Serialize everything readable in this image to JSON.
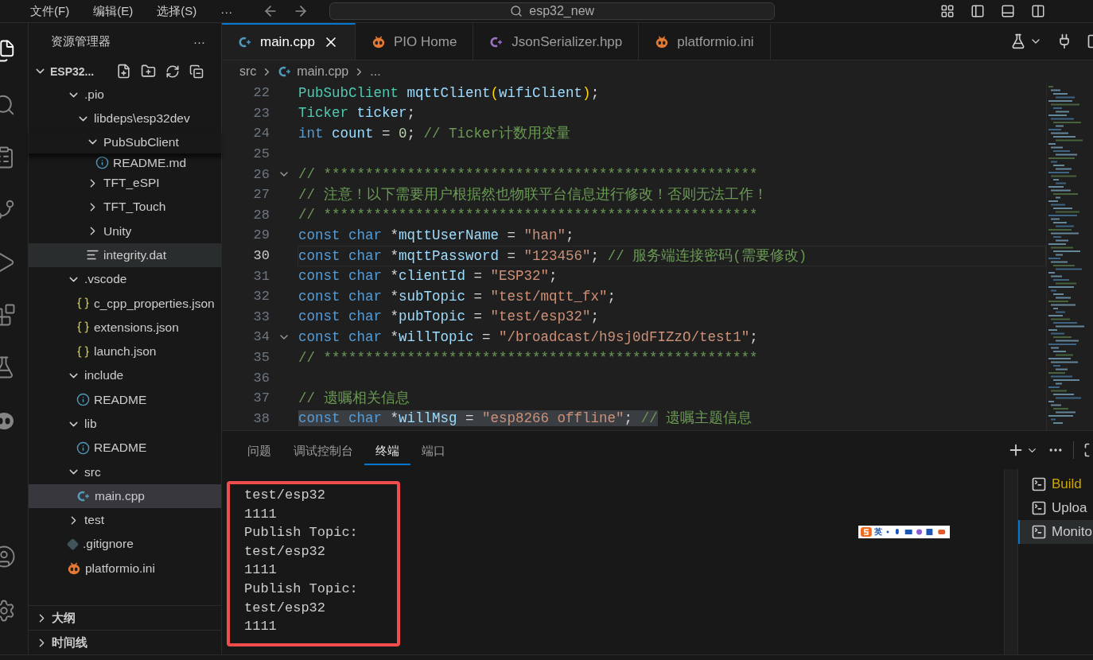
{
  "title_bar": {
    "menus": [
      "文件(F)",
      "编辑(E)",
      "选择(S)",
      "···"
    ],
    "search": "esp32_new"
  },
  "activity_bar": [
    {
      "kind": "explorer",
      "selected": true
    },
    {
      "kind": "search",
      "selected": false
    },
    {
      "kind": "notes",
      "selected": false
    },
    {
      "kind": "source-control",
      "selected": false
    },
    {
      "kind": "run",
      "selected": false
    },
    {
      "kind": "extensions",
      "selected": false
    },
    {
      "kind": "testing",
      "selected": false
    },
    {
      "kind": "platformio",
      "selected": false
    },
    {
      "kind": "account",
      "selected": false
    },
    {
      "kind": "settings",
      "selected": false
    }
  ],
  "sidebar": {
    "title": "资源管理器",
    "more": "···",
    "root": {
      "label": "ESP32...",
      "expanded": true
    },
    "tree": [
      {
        "label": ".pio",
        "kind": "folder",
        "expanded": true,
        "selected": false,
        "hovered": false,
        "covered": false,
        "sticky": false,
        "children": [
          {
            "label": "libdeps\\esp32dev",
            "kind": "folder",
            "expanded": true,
            "selected": false,
            "hovered": false,
            "covered": false,
            "sticky": false,
            "children": [
              {
                "label": "PubSubClient",
                "kind": "folder",
                "expanded": true,
                "selected": false,
                "hovered": false,
                "covered": false,
                "sticky": true,
                "children": [
                  {
                    "label": "README.md",
                    "kind": "readme",
                    "selected": false,
                    "hovered": false,
                    "covered": true,
                    "sticky": false
                  }
                ]
              },
              {
                "label": "TFT_eSPI",
                "kind": "folder",
                "expanded": false,
                "selected": false,
                "hovered": false,
                "covered": false,
                "sticky": false
              },
              {
                "label": "TFT_Touch",
                "kind": "folder",
                "expanded": false,
                "selected": false,
                "hovered": false,
                "covered": false,
                "sticky": false
              },
              {
                "label": "Unity",
                "kind": "folder",
                "expanded": false,
                "selected": false,
                "hovered": false,
                "covered": false,
                "sticky": false
              },
              {
                "label": "integrity.dat",
                "kind": "text",
                "selected": false,
                "hovered": true,
                "covered": false,
                "sticky": false
              }
            ]
          }
        ]
      },
      {
        "label": ".vscode",
        "kind": "folder",
        "expanded": true,
        "selected": false,
        "hovered": false,
        "covered": false,
        "sticky": false,
        "children": [
          {
            "label": "c_cpp_properties.json",
            "kind": "json",
            "selected": false,
            "hovered": false,
            "covered": false,
            "sticky": false
          },
          {
            "label": "extensions.json",
            "kind": "json",
            "selected": false,
            "hovered": false,
            "covered": false,
            "sticky": false
          },
          {
            "label": "launch.json",
            "kind": "json",
            "selected": false,
            "hovered": false,
            "covered": false,
            "sticky": false
          }
        ]
      },
      {
        "label": "include",
        "kind": "folder",
        "expanded": true,
        "selected": false,
        "hovered": false,
        "covered": false,
        "sticky": false,
        "children": [
          {
            "label": "README",
            "kind": "readme",
            "selected": false,
            "hovered": false,
            "covered": false,
            "sticky": false
          }
        ]
      },
      {
        "label": "lib",
        "kind": "folder",
        "expanded": true,
        "selected": false,
        "hovered": false,
        "covered": false,
        "sticky": false,
        "children": [
          {
            "label": "README",
            "kind": "readme",
            "selected": false,
            "hovered": false,
            "covered": false,
            "sticky": false
          }
        ]
      },
      {
        "label": "src",
        "kind": "folder",
        "expanded": true,
        "selected": false,
        "hovered": false,
        "covered": false,
        "sticky": false,
        "children": [
          {
            "label": "main.cpp",
            "kind": "cpp",
            "selected": true,
            "hovered": false,
            "covered": false,
            "sticky": false
          }
        ]
      },
      {
        "label": "test",
        "kind": "folder",
        "expanded": false,
        "selected": false,
        "hovered": false,
        "covered": false,
        "sticky": false
      },
      {
        "label": ".gitignore",
        "kind": "git",
        "selected": false,
        "hovered": false,
        "covered": false,
        "sticky": false
      },
      {
        "label": "platformio.ini",
        "kind": "platformio",
        "selected": false,
        "hovered": false,
        "covered": false,
        "sticky": false
      }
    ],
    "sections": [
      {
        "label": "大纲",
        "expanded": false
      },
      {
        "label": "时间线",
        "expanded": false
      }
    ]
  },
  "editor_tabs": [
    {
      "label": "main.cpp",
      "kind": "cpp",
      "selected": true
    },
    {
      "label": "PIO Home",
      "kind": "platformio",
      "selected": false
    },
    {
      "label": "JsonSerializer.hpp",
      "kind": "hpp",
      "selected": false
    },
    {
      "label": "platformio.ini",
      "kind": "platformio",
      "selected": false
    }
  ],
  "breadcrumb": [
    {
      "label": "src",
      "kind": "folder"
    },
    {
      "label": "main.cpp",
      "kind": "cpp"
    },
    {
      "label": "...",
      "kind": "more"
    }
  ],
  "code_lines": [
    {
      "number": "22",
      "current": false,
      "fold": false,
      "tokens": [
        {
          "kind": "type",
          "text": "PubSubClient"
        },
        {
          "kind": "variable",
          "text": " mqttClient"
        },
        {
          "kind": "bracket",
          "text": "("
        },
        {
          "kind": "variable",
          "text": "wifiClient"
        },
        {
          "kind": "bracket",
          "text": ")"
        },
        {
          "kind": "punct",
          "text": ";"
        }
      ]
    },
    {
      "number": "23",
      "current": false,
      "fold": false,
      "tokens": [
        {
          "kind": "type",
          "text": "Ticker"
        },
        {
          "kind": "variable",
          "text": " ticker"
        },
        {
          "kind": "punct",
          "text": ";"
        }
      ]
    },
    {
      "number": "24",
      "current": false,
      "fold": false,
      "tokens": [
        {
          "kind": "keyword",
          "text": "int"
        },
        {
          "kind": "variable",
          "text": " count"
        },
        {
          "kind": "punct",
          "text": " = "
        },
        {
          "kind": "number",
          "text": "0"
        },
        {
          "kind": "punct",
          "text": "; "
        },
        {
          "kind": "comment",
          "text": "// Ticker计数用变量"
        }
      ]
    },
    {
      "number": "25",
      "current": false,
      "fold": false
    },
    {
      "number": "26",
      "current": false,
      "fold": true,
      "tokens": [
        {
          "kind": "comment",
          "text": "// ****************************************************"
        }
      ]
    },
    {
      "number": "27",
      "current": false,
      "fold": false,
      "tokens": [
        {
          "kind": "comment",
          "text": "// 注意！以下需要用户根据然也物联平台信息进行修改！否则无法工作！"
        }
      ]
    },
    {
      "number": "28",
      "current": false,
      "fold": false,
      "tokens": [
        {
          "kind": "comment",
          "text": "// ****************************************************"
        }
      ]
    },
    {
      "number": "29",
      "current": false,
      "fold": false,
      "tokens": [
        {
          "kind": "keyword",
          "text": "const"
        },
        {
          "kind": "keyword",
          "text": " char"
        },
        {
          "kind": "punct",
          "text": " *"
        },
        {
          "kind": "variable",
          "text": "mqttUserName"
        },
        {
          "kind": "punct",
          "text": " = "
        },
        {
          "kind": "string",
          "text": "\"han\""
        },
        {
          "kind": "punct",
          "text": ";"
        }
      ]
    },
    {
      "number": "30",
      "current": true,
      "fold": false,
      "tokens": [
        {
          "kind": "keyword",
          "text": "const"
        },
        {
          "kind": "keyword",
          "text": " char"
        },
        {
          "kind": "punct",
          "text": " *"
        },
        {
          "kind": "variable",
          "text": "mqttPassword"
        },
        {
          "kind": "punct",
          "text": " = "
        },
        {
          "kind": "string",
          "text": "\"123456\""
        },
        {
          "kind": "punct",
          "text": "; "
        },
        {
          "kind": "comment",
          "text": "// 服务端连接密码(需要修改)"
        }
      ]
    },
    {
      "number": "31",
      "current": false,
      "fold": false,
      "tokens": [
        {
          "kind": "keyword",
          "text": "const"
        },
        {
          "kind": "keyword",
          "text": " char"
        },
        {
          "kind": "punct",
          "text": " *"
        },
        {
          "kind": "variable",
          "text": "clientId"
        },
        {
          "kind": "punct",
          "text": " = "
        },
        {
          "kind": "string",
          "text": "\"ESP32\""
        },
        {
          "kind": "punct",
          "text": ";"
        }
      ]
    },
    {
      "number": "32",
      "current": false,
      "fold": false,
      "tokens": [
        {
          "kind": "keyword",
          "text": "const"
        },
        {
          "kind": "keyword",
          "text": " char"
        },
        {
          "kind": "punct",
          "text": " *"
        },
        {
          "kind": "variable",
          "text": "subTopic"
        },
        {
          "kind": "punct",
          "text": " = "
        },
        {
          "kind": "string",
          "text": "\"test/mqtt_fx\""
        },
        {
          "kind": "punct",
          "text": ";"
        }
      ]
    },
    {
      "number": "33",
      "current": false,
      "fold": false,
      "tokens": [
        {
          "kind": "keyword",
          "text": "const"
        },
        {
          "kind": "keyword",
          "text": " char"
        },
        {
          "kind": "punct",
          "text": " *"
        },
        {
          "kind": "variable",
          "text": "pubTopic"
        },
        {
          "kind": "punct",
          "text": " = "
        },
        {
          "kind": "string",
          "text": "\"test/esp32\""
        },
        {
          "kind": "punct",
          "text": ";"
        }
      ]
    },
    {
      "number": "34",
      "current": false,
      "fold": true,
      "tokens": [
        {
          "kind": "keyword",
          "text": "const"
        },
        {
          "kind": "keyword",
          "text": " char"
        },
        {
          "kind": "punct",
          "text": " *"
        },
        {
          "kind": "variable",
          "text": "willTopic"
        },
        {
          "kind": "punct",
          "text": " = "
        },
        {
          "kind": "string",
          "text": "\"/broadcast/h9sj0dFIZzO/test1\""
        },
        {
          "kind": "punct",
          "text": ";"
        }
      ]
    },
    {
      "number": "35",
      "current": false,
      "fold": false,
      "tokens": [
        {
          "kind": "comment",
          "text": "// ****************************************************"
        }
      ]
    },
    {
      "number": "36",
      "current": false,
      "fold": false
    },
    {
      "number": "37",
      "current": false,
      "fold": false,
      "tokens": [
        {
          "kind": "comment",
          "text": "// 遗嘱相关信息"
        }
      ]
    },
    {
      "number": "38",
      "current": false,
      "fold": false,
      "selection": [
        {
          "kind": "keyword",
          "text": "const"
        },
        {
          "kind": "keyword",
          "text": " char"
        },
        {
          "kind": "punct",
          "text": " *"
        },
        {
          "kind": "variable",
          "text": "willMsg"
        },
        {
          "kind": "punct",
          "text": " = "
        },
        {
          "kind": "string",
          "text": "\"esp8266 offline\""
        },
        {
          "kind": "punct",
          "text": "; "
        },
        {
          "kind": "comment",
          "text": "//"
        }
      ],
      "tokens": [
        {
          "kind": "comment",
          "text": " 遗嘱主题信息"
        }
      ]
    }
  ],
  "panel_tabs": [
    {
      "label": "问题",
      "selected": false
    },
    {
      "label": "调试控制台",
      "selected": false
    },
    {
      "label": "终端",
      "selected": true
    },
    {
      "label": "端口",
      "selected": false
    }
  ],
  "terminal_lines": [
    "test/esp32",
    "1111",
    "Publish Topic:",
    "test/esp32",
    "1111",
    "Publish Topic:",
    "test/esp32",
    "1111"
  ],
  "terminal_list": [
    {
      "label": "Build",
      "color": "#cca700",
      "selected": false
    },
    {
      "label": "Uploa",
      "color": "#cccccc",
      "selected": false
    },
    {
      "label": "Monito",
      "color": "#cccccc",
      "selected": true
    }
  ],
  "ime_toolbar": {
    "label": "英"
  }
}
